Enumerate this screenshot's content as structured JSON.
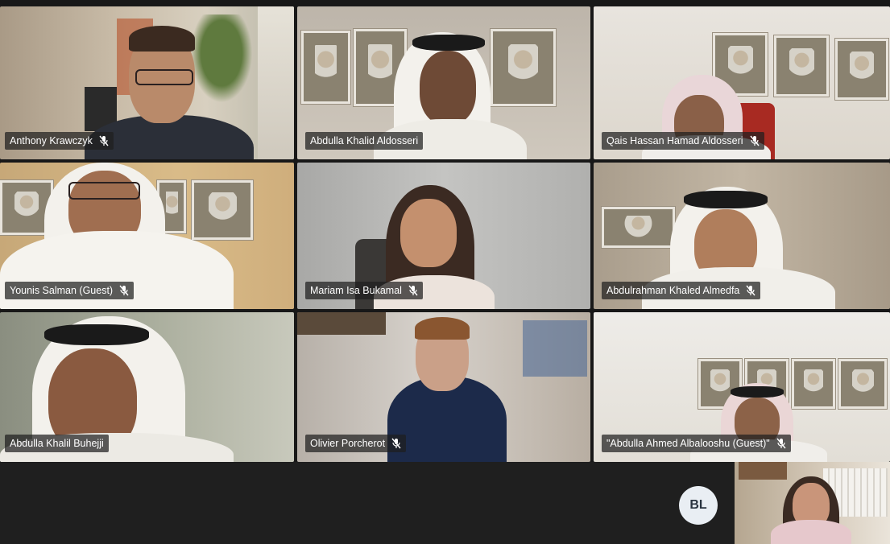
{
  "participants": [
    {
      "name": "Anthony Krawczyk",
      "muted": true
    },
    {
      "name": "Abdulla Khalid Aldosseri",
      "muted": false
    },
    {
      "name": "Qais Hassan Hamad Aldosseri",
      "muted": true
    },
    {
      "name": "Younis Salman (Guest)",
      "muted": true
    },
    {
      "name": "Mariam Isa Bukamal",
      "muted": true
    },
    {
      "name": "Abdulrahman Khaled Almedfa",
      "muted": true
    },
    {
      "name": "Abdulla Khalil Buhejji",
      "muted": false
    },
    {
      "name": "Olivier Porcherot",
      "muted": true
    },
    {
      "name": "\"Abdulla Ahmed Albalooshu (Guest)\"",
      "muted": true
    }
  ],
  "bottom": {
    "avatar_initials": "BL"
  },
  "icons": {
    "muted": "mic-off-icon"
  },
  "colors": {
    "background": "#181818",
    "name_tag_bg": "#1e1e1e",
    "avatar_bg": "#e9eef3"
  }
}
